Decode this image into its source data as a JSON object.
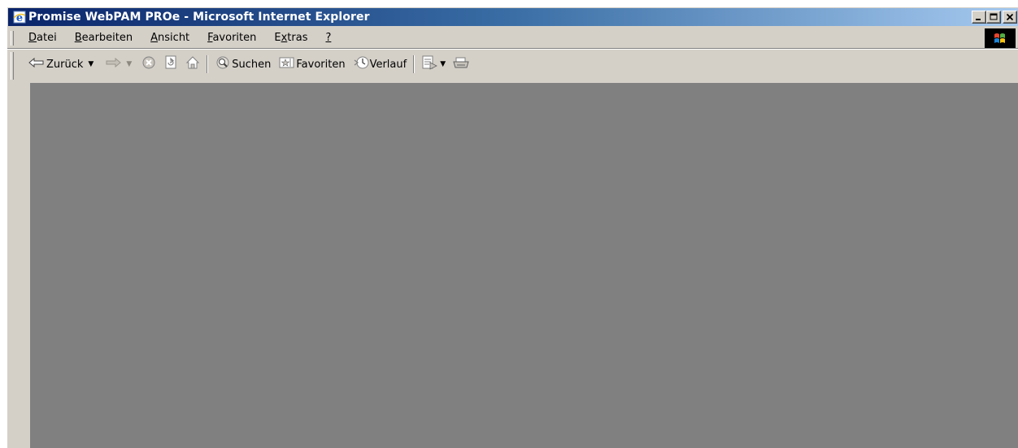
{
  "window": {
    "title": "Promise WebPAM PROe - Microsoft Internet Explorer",
    "buttons": {
      "minimize": "_",
      "maximize": "□",
      "close": "×"
    }
  },
  "menu": {
    "items": [
      {
        "label": "Datei",
        "access_key": "D"
      },
      {
        "label": "Bearbeiten",
        "access_key": "B"
      },
      {
        "label": "Ansicht",
        "access_key": "A"
      },
      {
        "label": "Favoriten",
        "access_key": "F"
      },
      {
        "label": "Extras",
        "access_key": "x"
      },
      {
        "label": "?",
        "access_key": "?"
      }
    ]
  },
  "toolbar": {
    "back_label": "Zurück",
    "search_label": "Suchen",
    "favorites_label": "Favoriten",
    "history_label": "Verlauf"
  },
  "colors": {
    "titlebar_start": "#0a246a",
    "titlebar_end": "#a6caf0",
    "chrome": "#d4d0c8",
    "content_bg": "#808080"
  },
  "icons": {
    "app": "ie-icon",
    "logo": "windows-flag-icon",
    "back": "back-arrow-icon",
    "forward": "forward-arrow-icon",
    "stop": "stop-icon",
    "refresh": "refresh-icon",
    "home": "home-icon",
    "search": "search-icon",
    "favorites": "favorites-icon",
    "history": "history-icon",
    "mail": "mail-icon",
    "print": "print-icon"
  }
}
